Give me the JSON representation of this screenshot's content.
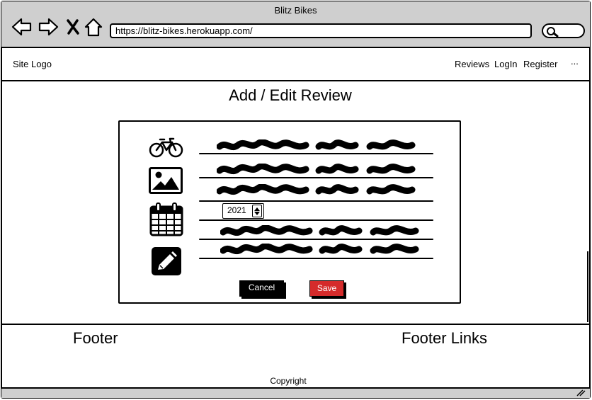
{
  "window": {
    "title": "Blitz Bikes"
  },
  "browser": {
    "url": "https://blitz-bikes.herokuapp.com/",
    "back_icon": "back-arrow-icon",
    "forward_icon": "forward-arrow-icon",
    "stop_icon": "close-x-icon",
    "home_icon": "home-icon",
    "search_icon": "search-icon"
  },
  "site_nav": {
    "logo": "Site Logo",
    "links": [
      "Reviews",
      "LogIn",
      "Register"
    ],
    "more": "..."
  },
  "page": {
    "title": "Add / Edit Review"
  },
  "form": {
    "icons": [
      "bicycle-icon",
      "image-icon",
      "calendar-icon",
      "edit-pencil-icon"
    ],
    "year_value": "2021",
    "cancel_label": "Cancel",
    "save_label": "Save",
    "save_color": "#d52b2b"
  },
  "footer": {
    "left_heading": "Footer",
    "right_heading": "Footer Links",
    "copyright": "Copyright"
  }
}
